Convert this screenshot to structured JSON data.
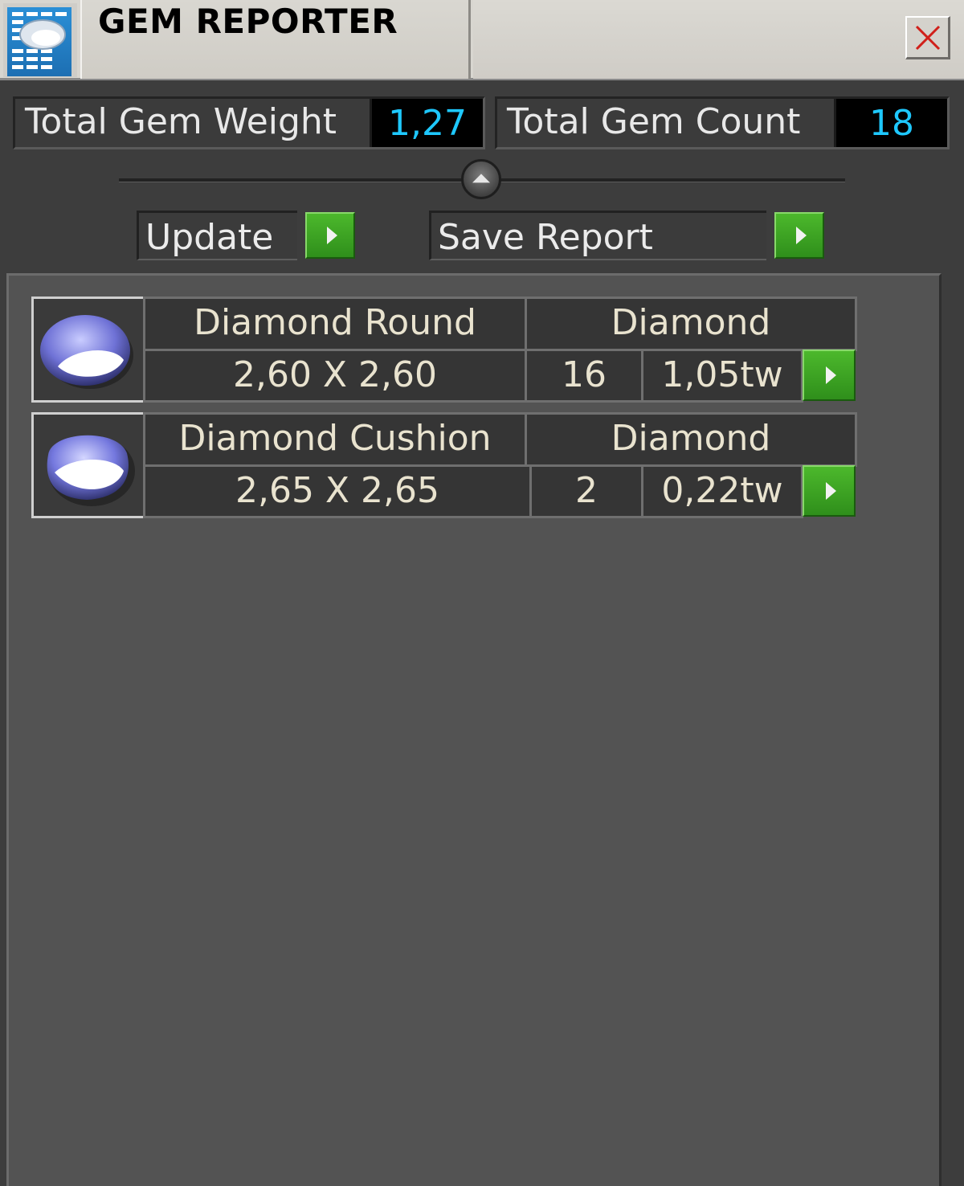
{
  "titlebar": {
    "title": "GEM REPORTER"
  },
  "summary": {
    "weight_label": "Total Gem Weight",
    "weight_value": "1,27",
    "count_label": "Total Gem Count",
    "count_value": "18"
  },
  "actions": {
    "update_label": "Update",
    "save_label": "Save Report"
  },
  "gems": [
    {
      "name": "Diamond Round",
      "material": "Diamond",
      "size": "2,60 X 2,60",
      "count": "16",
      "weight": "1,05tw"
    },
    {
      "name": "Diamond Cushion",
      "material": "Diamond",
      "size": "2,65 X 2,65",
      "count": "2",
      "weight": "0,22tw"
    }
  ],
  "icons": {
    "app": "gem-report-icon",
    "close": "close-icon",
    "collapse": "collapse-up-icon",
    "go": "play-arrow-icon",
    "gem": "gem-stone-icon"
  },
  "colors": {
    "value_text": "#1ec8ff",
    "go_button": "#3aa321",
    "close_x": "#d0201a"
  }
}
